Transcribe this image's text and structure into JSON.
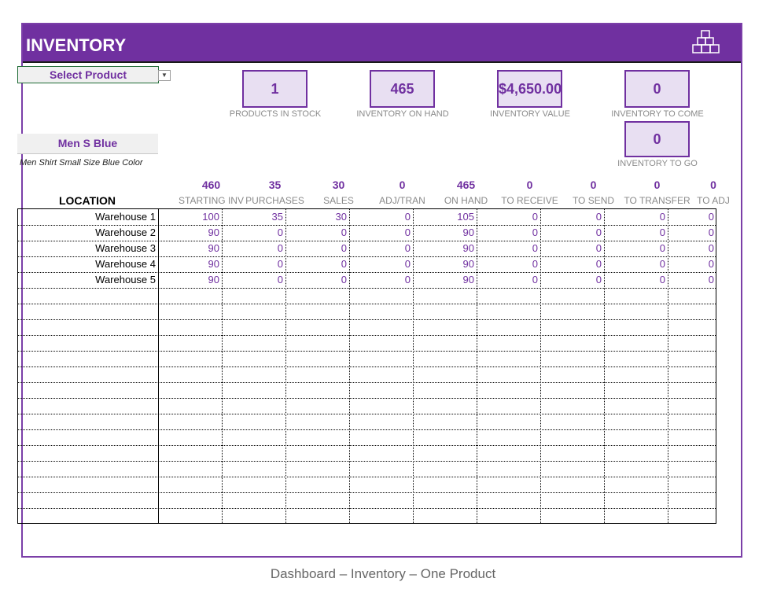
{
  "header": {
    "title": "INVENTORY"
  },
  "controls": {
    "select_label": "Select Product",
    "dropdown_glyph": "▼"
  },
  "kpis": [
    {
      "value": "1",
      "label": "PRODUCTS IN STOCK"
    },
    {
      "value": "465",
      "label": "INVENTORY ON HAND"
    },
    {
      "value": "$4,650.00",
      "label": "INVENTORY VALUE"
    },
    {
      "value": "0",
      "label": "INVENTORY TO COME"
    },
    {
      "value": "0",
      "label": "INVENTORY TO GO"
    }
  ],
  "product": {
    "name": "Men S Blue",
    "description": "Men Shirt Small Size Blue Color"
  },
  "table": {
    "location_header": "LOCATION",
    "columns": [
      {
        "label": "STARTING INV",
        "total": "460"
      },
      {
        "label": "PURCHASES",
        "total": "35"
      },
      {
        "label": "SALES",
        "total": "30"
      },
      {
        "label": "ADJ/TRAN",
        "total": "0"
      },
      {
        "label": "ON HAND",
        "total": "465"
      },
      {
        "label": "TO RECEIVE",
        "total": "0"
      },
      {
        "label": "TO SEND",
        "total": "0"
      },
      {
        "label": "TO TRANSFER",
        "total": "0"
      },
      {
        "label": "TO ADJ",
        "total": "0"
      }
    ],
    "rows": [
      {
        "location": "Warehouse 1",
        "values": [
          "100",
          "35",
          "30",
          "0",
          "105",
          "0",
          "0",
          "0",
          "0"
        ]
      },
      {
        "location": "Warehouse 2",
        "values": [
          "90",
          "0",
          "0",
          "0",
          "90",
          "0",
          "0",
          "0",
          "0"
        ]
      },
      {
        "location": "Warehouse 3",
        "values": [
          "90",
          "0",
          "0",
          "0",
          "90",
          "0",
          "0",
          "0",
          "0"
        ]
      },
      {
        "location": "Warehouse 4",
        "values": [
          "90",
          "0",
          "0",
          "0",
          "90",
          "0",
          "0",
          "0",
          "0"
        ]
      },
      {
        "location": "Warehouse 5",
        "values": [
          "90",
          "0",
          "0",
          "0",
          "90",
          "0",
          "0",
          "0",
          "0"
        ]
      }
    ]
  },
  "caption": "Dashboard – Inventory – One Product",
  "colors": {
    "accent": "#7030a0",
    "kpi_fill": "#e8dff2"
  }
}
